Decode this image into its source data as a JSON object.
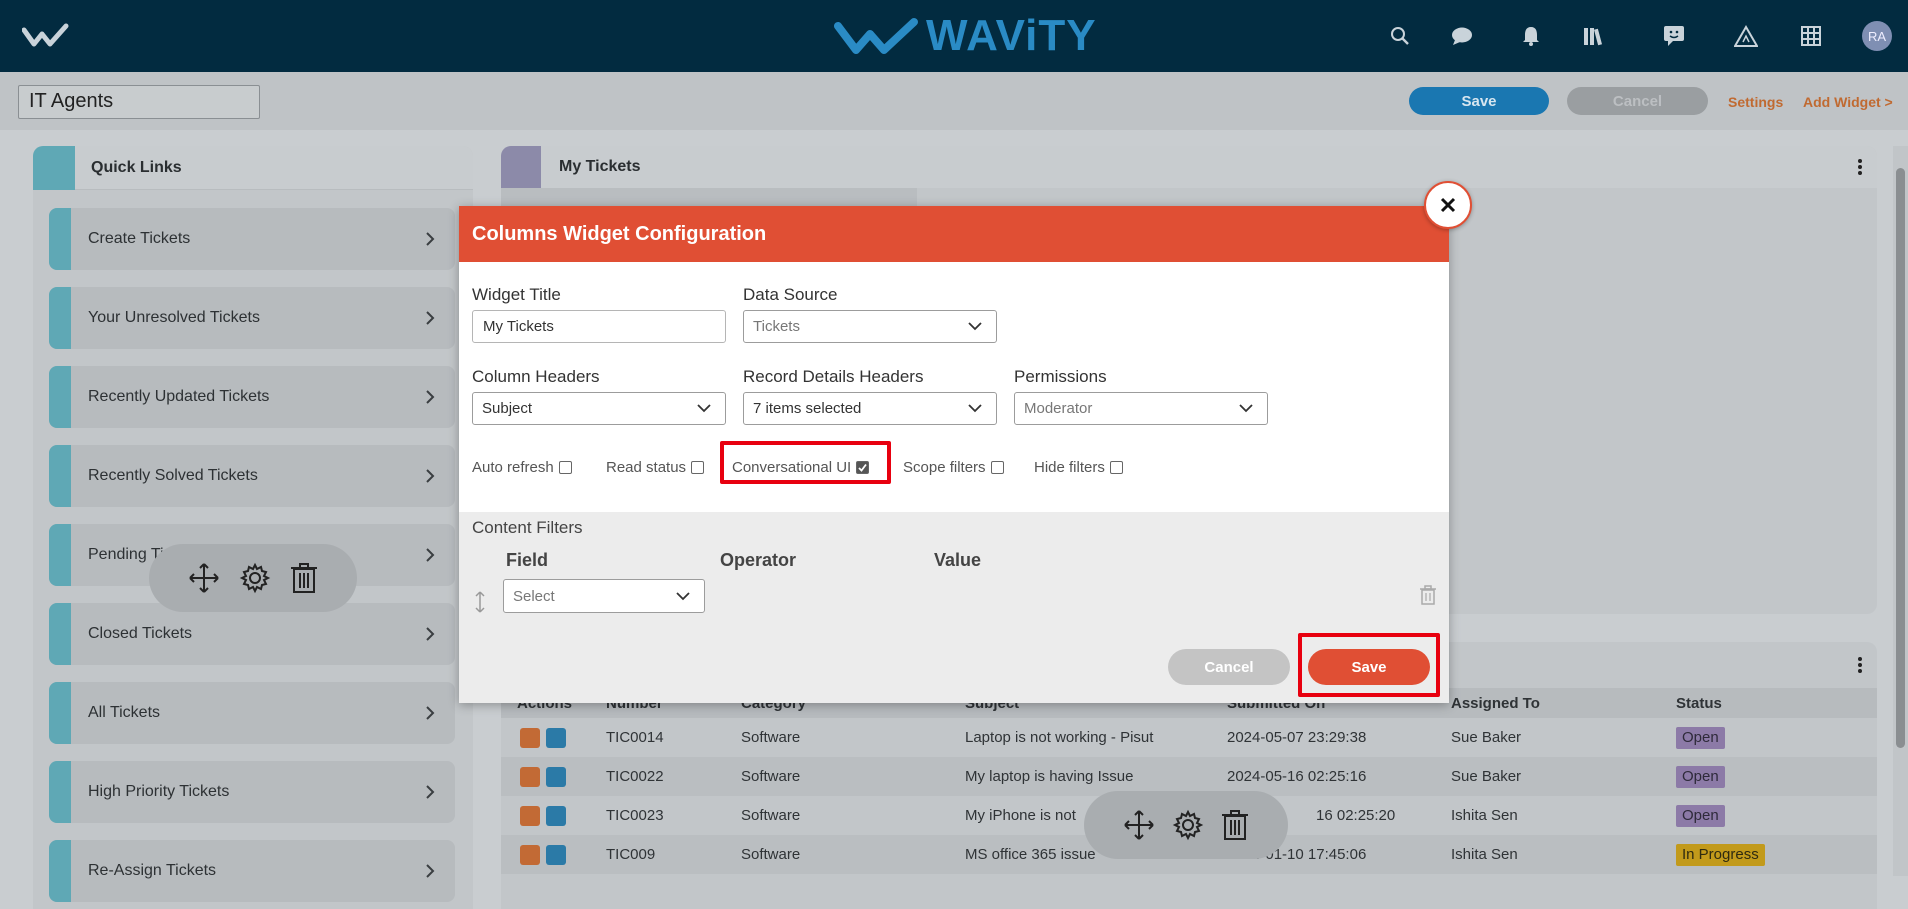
{
  "brand": {
    "name": "WAViTY"
  },
  "topnav": {
    "icons": [
      "search-icon",
      "chat-icon",
      "bell-icon",
      "library-icon",
      "feedback-icon",
      "alert-triangle-icon",
      "apps-grid-icon"
    ],
    "avatar_initials": "RA"
  },
  "toolbar": {
    "dashboard_title": "IT Agents",
    "save_label": "Save",
    "cancel_label": "Cancel",
    "settings_label": "Settings",
    "add_widget_label": "Add Widget >"
  },
  "quick_links": {
    "title": "Quick Links",
    "items": [
      "Create Tickets",
      "Your Unresolved Tickets",
      "Recently Updated Tickets",
      "Recently Solved Tickets",
      "Pending Ti",
      "Closed Tickets",
      "All Tickets",
      "High Priority Tickets",
      "Re-Assign Tickets"
    ]
  },
  "my_tickets_panel": {
    "title": "My Tickets"
  },
  "tickets_table": {
    "headers": [
      "Actions",
      "Number",
      "Category",
      "Subject",
      "Submitted On",
      "Assigned To",
      "Status"
    ],
    "rows": [
      {
        "number": "TIC0014",
        "category": "Software",
        "subject": "Laptop is not working - Pisut",
        "submitted": "2024-05-07 23:29:38",
        "assigned": "Sue Baker",
        "status": "Open"
      },
      {
        "number": "TIC0022",
        "category": "Software",
        "subject": "My laptop is having Issue",
        "submitted": "2024-05-16 02:25:16",
        "assigned": "Sue Baker",
        "status": "Open"
      },
      {
        "number": "TIC0023",
        "category": "Software",
        "subject": "My iPhone is not",
        "submitted": "16 02:25:20",
        "assigned": "Ishita Sen",
        "status": "Open"
      },
      {
        "number": "TIC009",
        "category": "Software",
        "subject": "MS office 365 issue",
        "submitted": "2024-01-10 17:45:06",
        "assigned": "Ishita Sen",
        "status": "In Progress"
      }
    ]
  },
  "modal": {
    "title": "Columns Widget Configuration",
    "widget_title_label": "Widget Title",
    "widget_title_value": "My Tickets",
    "data_source_label": "Data Source",
    "data_source_value": "Tickets",
    "column_headers_label": "Column Headers",
    "column_headers_value": "Subject",
    "record_details_label": "Record Details Headers",
    "record_details_value": "7 items selected",
    "permissions_label": "Permissions",
    "permissions_value": "Moderator",
    "checkboxes": [
      {
        "label": "Auto refresh",
        "checked": false
      },
      {
        "label": "Read status",
        "checked": false
      },
      {
        "label": "Conversational UI",
        "checked": true
      },
      {
        "label": "Scope filters",
        "checked": false
      },
      {
        "label": "Hide filters",
        "checked": false
      }
    ],
    "content_filters_label": "Content Filters",
    "filter_columns": [
      "Field",
      "Operator",
      "Value"
    ],
    "field_select_value": "Select",
    "cancel_label": "Cancel",
    "save_label": "Save"
  },
  "colors": {
    "nav_bg": "#022b40",
    "modal_header": "#e04f34",
    "accent_blue": "#1a77b1",
    "highlight": "#e8000f"
  }
}
